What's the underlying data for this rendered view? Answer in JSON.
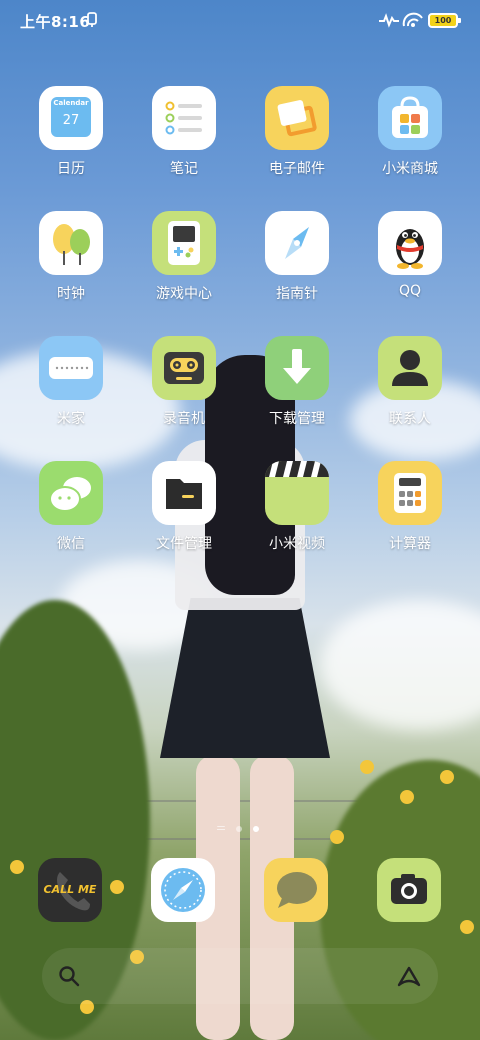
{
  "status_bar": {
    "time": "上午8:16",
    "battery": "100"
  },
  "apps": [
    {
      "label": "日历",
      "icon": "calendar-icon",
      "cal_head": "Calendar",
      "cal_day": "27"
    },
    {
      "label": "笔记",
      "icon": "notes-icon"
    },
    {
      "label": "电子邮件",
      "icon": "email-icon"
    },
    {
      "label": "小米商城",
      "icon": "mi-store-icon"
    },
    {
      "label": "时钟",
      "icon": "clock-icon"
    },
    {
      "label": "游戏中心",
      "icon": "game-center-icon"
    },
    {
      "label": "指南针",
      "icon": "compass-icon"
    },
    {
      "label": "QQ",
      "icon": "qq-penguin-icon"
    },
    {
      "label": "米家",
      "icon": "mijia-icon"
    },
    {
      "label": "录音机",
      "icon": "recorder-icon"
    },
    {
      "label": "下载管理",
      "icon": "download-icon"
    },
    {
      "label": "联系人",
      "icon": "contacts-icon"
    },
    {
      "label": "微信",
      "icon": "wechat-icon"
    },
    {
      "label": "文件管理",
      "icon": "folder-icon"
    },
    {
      "label": "小米视频",
      "icon": "clapperboard-icon"
    },
    {
      "label": "计算器",
      "icon": "calculator-icon"
    }
  ],
  "dock": [
    {
      "name": "phone",
      "icon": "phone-icon",
      "text": "CALL ME"
    },
    {
      "name": "browser",
      "icon": "compass-browser-icon"
    },
    {
      "name": "messages",
      "icon": "message-bubble-icon"
    },
    {
      "name": "camera",
      "icon": "camera-icon"
    }
  ],
  "page_indicator": {
    "pages": 3,
    "active": 3
  },
  "colors": {
    "accent_yellow": "#f7d35c",
    "accent_green": "#c5e07a",
    "accent_blue": "#8cc7f5"
  }
}
